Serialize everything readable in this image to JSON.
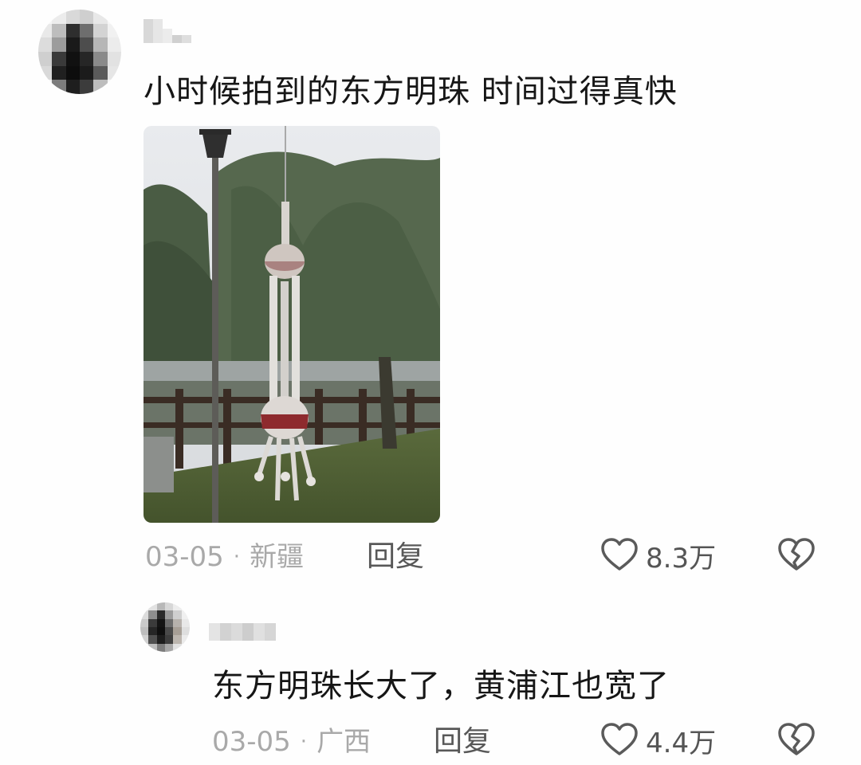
{
  "comment": {
    "text": "小时候拍到的东方明珠 时间过得真快",
    "date": "03-05",
    "separator": "·",
    "location": "新疆",
    "reply_label": "回复",
    "likes": "8.3万"
  },
  "reply_comment": {
    "text": "东方明珠长大了，黄浦江也宽了",
    "date": "03-05",
    "separator": "·",
    "location": "广西",
    "reply_label": "回复",
    "likes": "4.4万"
  },
  "icons": {
    "like": "heart-outline-icon",
    "dislike": "broken-heart-icon"
  },
  "colors": {
    "meta_text": "#a9a9a9",
    "reply_text": "#585858",
    "body_text": "#161616"
  }
}
